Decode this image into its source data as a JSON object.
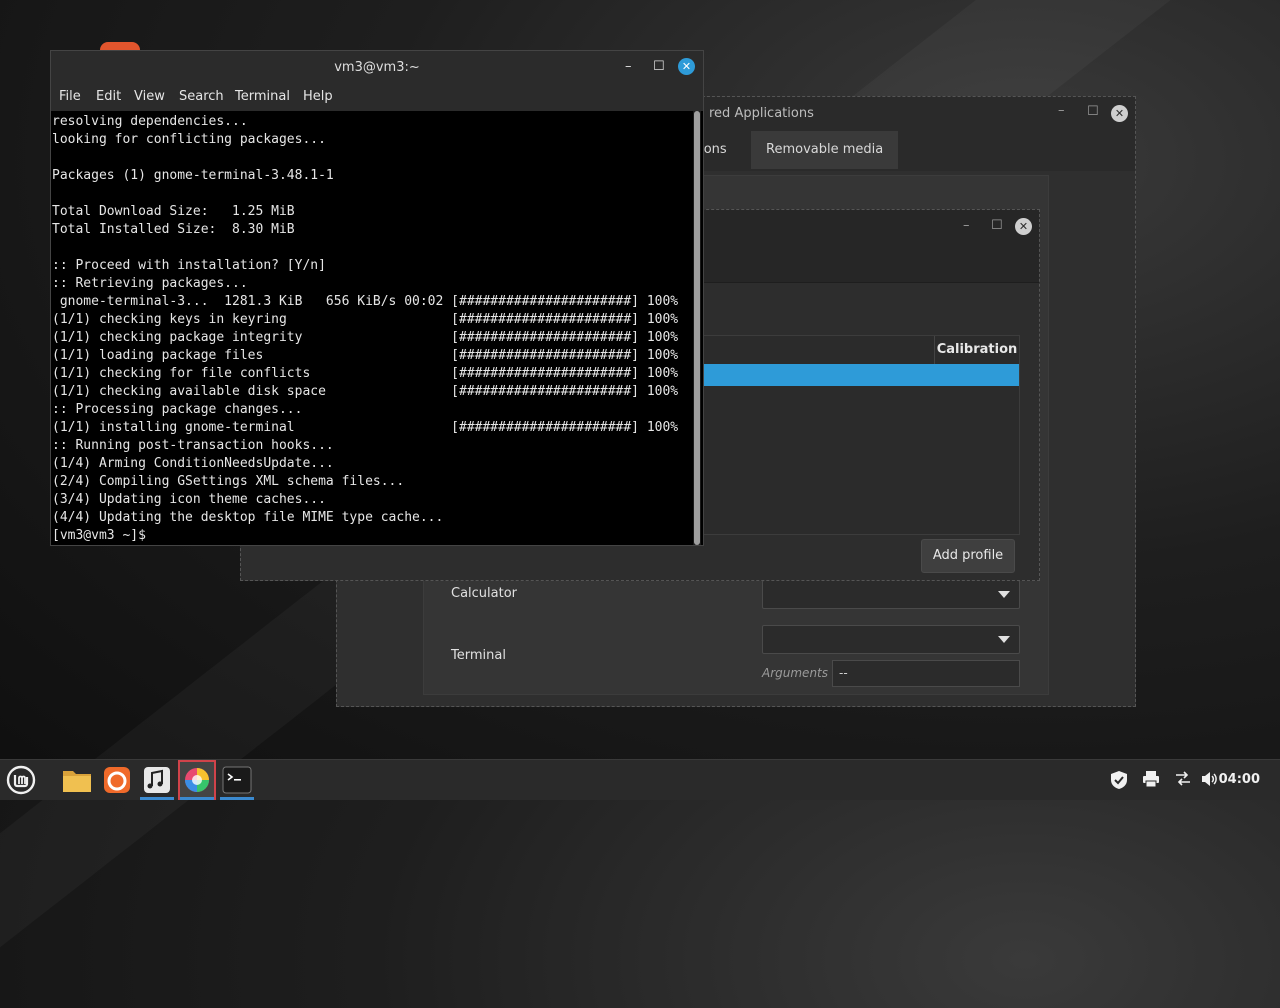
{
  "terminal": {
    "title": "vm3@vm3:~",
    "menu": [
      "File",
      "Edit",
      "View",
      "Search",
      "Terminal",
      "Help"
    ],
    "lines": [
      "resolving dependencies...",
      "looking for conflicting packages...",
      "",
      "Packages (1) gnome-terminal-3.48.1-1",
      "",
      "Total Download Size:   1.25 MiB",
      "Total Installed Size:  8.30 MiB",
      "",
      ":: Proceed with installation? [Y/n]",
      ":: Retrieving packages...",
      " gnome-terminal-3...  1281.3 KiB   656 KiB/s 00:02 [######################] 100%",
      "(1/1) checking keys in keyring                     [######################] 100%",
      "(1/1) checking package integrity                   [######################] 100%",
      "(1/1) loading package files                        [######################] 100%",
      "(1/1) checking for file conflicts                  [######################] 100%",
      "(1/1) checking available disk space                [######################] 100%",
      ":: Processing package changes...",
      "(1/1) installing gnome-terminal                    [######################] 100%",
      ":: Running post-transaction hooks...",
      "(1/4) Arming ConditionNeedsUpdate...",
      "(2/4) Compiling GSettings XML schema files...",
      "(3/4) Updating icon theme caches...",
      "(4/4) Updating the desktop file MIME type cache...",
      "[vm3@vm3 ~]$"
    ]
  },
  "preferred_apps": {
    "title_partial": "red Applications",
    "tab_partial": "tions",
    "tab_removable": "Removable media",
    "calculator_label": "Calculator",
    "terminal_label": "Terminal",
    "arguments_label": "Arguments",
    "arguments_value": "--"
  },
  "color_window": {
    "column_header": "Calibration",
    "add_profile_label": "Add profile"
  },
  "panel": {
    "clock": "04:00",
    "launchers": [
      "menu-icon",
      "files-icon",
      "firefox-icon",
      "media-icon",
      "color-icon",
      "terminal-icon"
    ],
    "tray": [
      "shield-icon",
      "printer-icon",
      "network-icon",
      "volume-icon"
    ]
  },
  "colors": {
    "accent": "#3b8ad0",
    "selection": "#2e9bd8"
  }
}
